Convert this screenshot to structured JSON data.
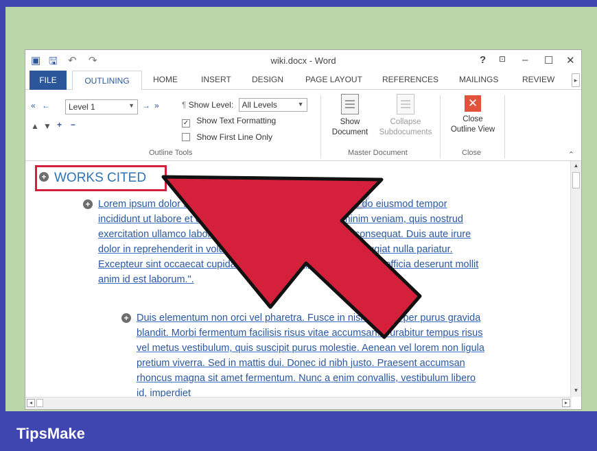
{
  "window": {
    "title": "wiki.docx - Word"
  },
  "title_controls": {
    "help": "?",
    "minimize": "–",
    "maximize": "☐",
    "close": "✕"
  },
  "tabs": {
    "file": "FILE",
    "active": "OUTLINING",
    "items": [
      "HOME",
      "INSERT",
      "DESIGN",
      "PAGE LAYOUT",
      "REFERENCES",
      "MAILINGS",
      "REVIEW"
    ]
  },
  "ribbon": {
    "level_value": "Level 1",
    "show_level_label": "Show Level:",
    "show_level_value": "All Levels",
    "show_text_formatting": "Show Text Formatting",
    "show_first_line_only": "Show First Line Only",
    "outline_tools_label": "Outline Tools",
    "show_document": [
      "Show",
      "Document"
    ],
    "collapse_subdocuments": [
      "Collapse",
      "Subdocuments"
    ],
    "master_document_label": "Master Document",
    "close_outline_view": [
      "Close",
      "Outline View"
    ],
    "close_label": "Close"
  },
  "document": {
    "heading": "WORKS CITED",
    "para1": "Lorem ipsum dolor sit amet, consectetur adipiscing elit, sed do eiusmod tempor incididunt ut labore et dolore magna aliqua. Ut enim ad minim veniam, quis nostrud exercitation ullamco laboris nisi ut aliquip ex ea commodo consequat. Duis aute irure dolor in reprehenderit in voluptate velit esse cillum dolore eu fugiat nulla pariatur. Excepteur sint occaecat cupidatat non proident, sunt in culpa qui officia deserunt mollit anim id est laborum.\".",
    "para2": "Duis elementum non orci vel pharetra. Fusce in nisi ullamcorper purus gravida blandit. Morbi fermentum facilisis risus vitae accumsan. Curabitur tempus risus vel metus vestibulum, quis suscipit purus molestie. Aenean vel lorem non ligula pretium viverra. Sed in mattis dui. Donec id nibh justo. Praesent accumsan rhoncus magna sit amet fermentum. Nunc a enim convallis, vestibulum libero id, imperdiet"
  },
  "watermark": "TipsMake",
  "brand": "TipsMake",
  "colors": {
    "accent": "#2b579a",
    "highlight_box": "#d4203b",
    "arrow": "#d4203b",
    "banner": "#3f46b0",
    "frame": "#b9d7a8"
  },
  "icons": [
    "word-app-icon",
    "save-icon",
    "undo-icon",
    "redo-icon",
    "promote-icon",
    "demote-icon",
    "move-up-icon",
    "move-down-icon",
    "expand-icon",
    "collapse-icon",
    "show-document-icon",
    "collapse-subdocuments-icon",
    "close-outline-icon",
    "outline-plus-icon",
    "pointer-arrow-icon"
  ]
}
